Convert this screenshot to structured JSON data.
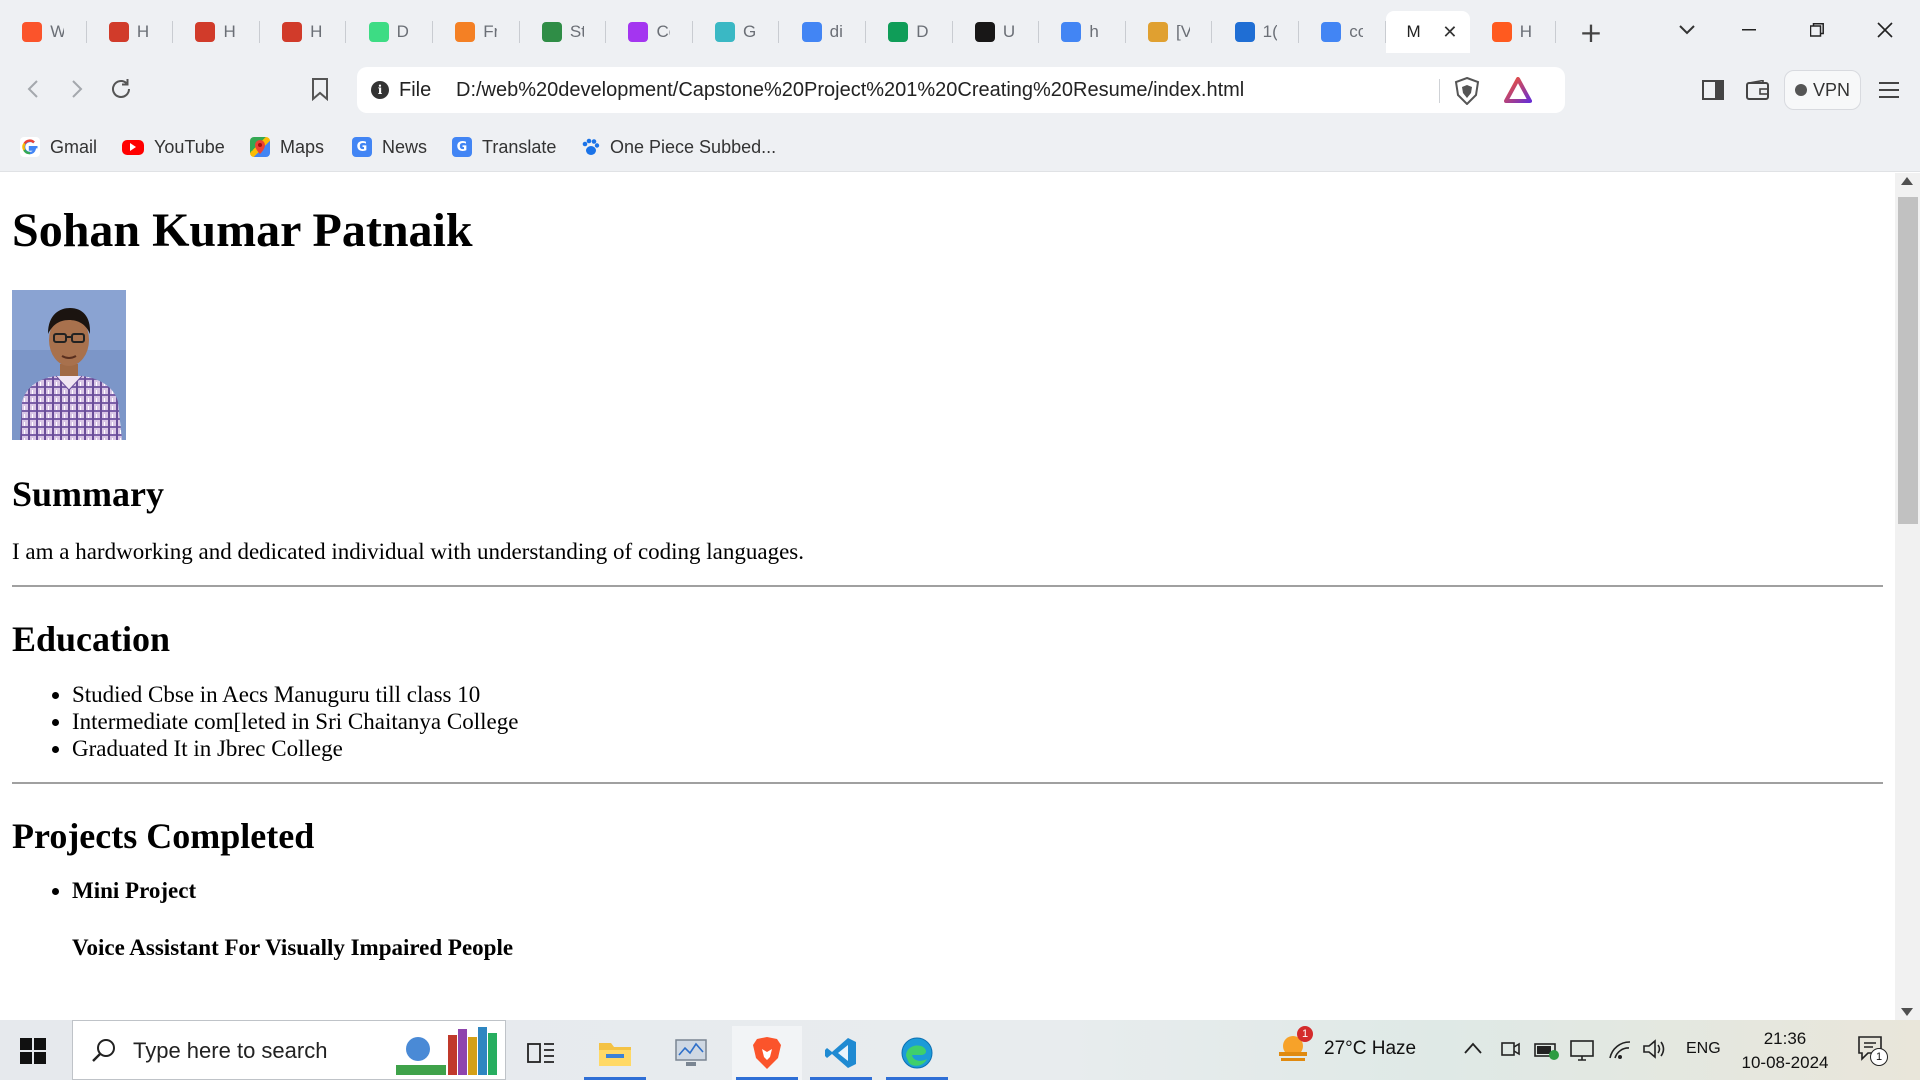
{
  "browser": {
    "tabs": [
      {
        "title": "W",
        "favicon": "brave-lion-icon",
        "color": "#fb542b"
      },
      {
        "title": "H",
        "favicon": "myhp-icon",
        "color": "#d13b2a"
      },
      {
        "title": "H",
        "favicon": "myhp-icon",
        "color": "#d13b2a"
      },
      {
        "title": "H",
        "favicon": "myhp-icon",
        "color": "#d13b2a"
      },
      {
        "title": "D",
        "favicon": "android-icon",
        "color": "#3ddc84"
      },
      {
        "title": "Fr",
        "favicon": "stackoverflow-icon",
        "color": "#f48024"
      },
      {
        "title": "St",
        "favicon": "geeksforgeeks-icon",
        "color": "#2f8d46"
      },
      {
        "title": "Co",
        "favicon": "udemy-icon",
        "color": "#a435f0"
      },
      {
        "title": "G",
        "favicon": "dinosaur-icon",
        "color": "#3ab8c4"
      },
      {
        "title": "di",
        "favicon": "google-icon",
        "color": "#4285f4"
      },
      {
        "title": "D",
        "favicon": "dev-icon",
        "color": "#0f9d58"
      },
      {
        "title": "U",
        "favicon": "github-icon",
        "color": "#181717"
      },
      {
        "title": "h",
        "favicon": "google-icon",
        "color": "#4285f4"
      },
      {
        "title": "[V",
        "favicon": "worker-icon",
        "color": "#e0a030"
      },
      {
        "title": "1(",
        "favicon": "c-circle-icon",
        "color": "#1f6ed4"
      },
      {
        "title": "cc",
        "favicon": "google-icon",
        "color": "#4285f4"
      },
      {
        "title": "M",
        "favicon": "page-icon",
        "color": "#ffffff",
        "active": true
      },
      {
        "title": "H",
        "favicon": "orange-square-icon",
        "color": "#ff5a1f"
      }
    ],
    "address": {
      "scheme_label": "File",
      "url": "D:/web%20development/Capstone%20Project%201%20Creating%20Resume/index.html"
    },
    "vpn_label": "VPN",
    "bookmarks": [
      {
        "label": "Gmail",
        "icon": "google-icon"
      },
      {
        "label": "YouTube",
        "icon": "youtube-icon"
      },
      {
        "label": "Maps",
        "icon": "maps-icon"
      },
      {
        "label": "News",
        "icon": "news-icon"
      },
      {
        "label": "Translate",
        "icon": "translate-icon"
      },
      {
        "label": "One Piece Subbed...",
        "icon": "paw-icon"
      }
    ]
  },
  "resume": {
    "name": "Sohan Kumar Patnaik",
    "summary_title": "Summary",
    "summary_text": "I am a hardworking and dedicated individual with understanding of coding languages.",
    "education_title": "Education",
    "education": [
      "Studied Cbse in Aecs Manuguru till class 10",
      "Intermediate com[leted in Sri Chaitanya College",
      "Graduated It in Jbrec College"
    ],
    "projects_title": "Projects Completed",
    "projects": [
      "Mini Project"
    ],
    "project_desc": "Voice Assistant For Visually Impaired People"
  },
  "taskbar": {
    "search_placeholder": "Type here to search",
    "weather": "27°C  Haze",
    "weather_badge": "1",
    "language": "ENG",
    "time": "21:36",
    "date": "10-08-2024",
    "notification_count": "1"
  }
}
